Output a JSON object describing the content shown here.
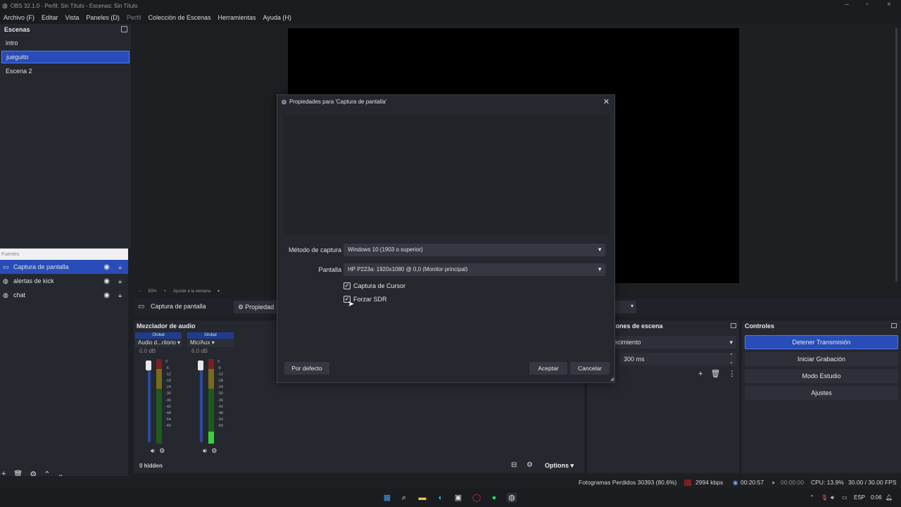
{
  "window": {
    "title": "OBS 32.1.0 - Perfil: Sin Título - Escenas: Sin Título"
  },
  "menu": [
    {
      "label": "Archivo (F)"
    },
    {
      "label": "Editar"
    },
    {
      "label": "Vista"
    },
    {
      "label": "Paneles (D)"
    },
    {
      "label": "Perfil"
    },
    {
      "label": "Colección de Escenas"
    },
    {
      "label": "Herramientas"
    },
    {
      "label": "Ayuda (H)"
    }
  ],
  "scenes": {
    "title": "Escenas",
    "items": [
      "intro",
      "jueguito",
      "Escena 2"
    ],
    "selected": "jueguito"
  },
  "zoom": {
    "minus": "−",
    "value": "50%",
    "plus": "+",
    "fit_label": "Ajustar a la ventana"
  },
  "sources": {
    "title": "Fuentes",
    "items": [
      {
        "name": "Captura de pantalla",
        "icon": "monitor-icon",
        "selected": true
      },
      {
        "name": "alertas de kick",
        "icon": "globe-icon",
        "selected": false
      },
      {
        "name": "chat",
        "icon": "globe-icon",
        "selected": false
      }
    ]
  },
  "source_toolbar": {
    "name": "Captura de pantalla",
    "props_label": "Propiedad"
  },
  "mixer": {
    "title": "Mezclador de audio",
    "channels": [
      {
        "scope": "Global",
        "name": "Audio d...ritorio",
        "db": "0.0 dB",
        "level": 0
      },
      {
        "scope": "Global",
        "name": "Mic/Aux",
        "db": "6.0 dB",
        "level": 0.22
      }
    ],
    "ticks": [
      "0",
      "-6",
      "-12",
      "-18",
      "-24",
      "-30",
      "-36",
      "-42",
      "-48",
      "-54",
      "-60"
    ],
    "hidden_label": "0 hidden",
    "options_label": "Options"
  },
  "transitions": {
    "title": "iones de escena",
    "selected": "ecimiento",
    "duration": "300 ms"
  },
  "controls": {
    "title": "Controles",
    "buttons": [
      {
        "label": "Detener Transmisión",
        "active": true
      },
      {
        "label": "Iniciar Grabación",
        "active": false
      },
      {
        "label": "Modo Estudio",
        "active": false
      },
      {
        "label": "Ajustes",
        "active": false
      }
    ]
  },
  "status": {
    "dropped": "Fotogramas Perdidos 30393 (80.6%)",
    "bitrate": "2994 kbps",
    "stream_time": "00:20:57",
    "rec_time": "00:00:00",
    "cpu": "CPU: 13.9%",
    "fps": "30.00 / 30.00 FPS"
  },
  "dialog": {
    "title": "Propiedades para 'Captura de pantalla'",
    "method_label": "Método de captura",
    "method_value": "Windows 10 (1903 o superior)",
    "screen_label": "Pantalla",
    "screen_value": "HP P223a: 1920x1080 @ 0,0 (Monitor principal)",
    "cursor_label": "Captura de Cursor",
    "cursor_checked": true,
    "sdr_label": "Forzar SDR",
    "sdr_checked": true,
    "default_btn": "Por defecto",
    "ok_btn": "Aceptar",
    "cancel_btn": "Cancelar"
  },
  "taskbar": {
    "lang": "ESP",
    "clock": "0:06"
  },
  "colors": {
    "accent": "#284cb8",
    "panel": "#262830",
    "background": "#1e1f23"
  }
}
